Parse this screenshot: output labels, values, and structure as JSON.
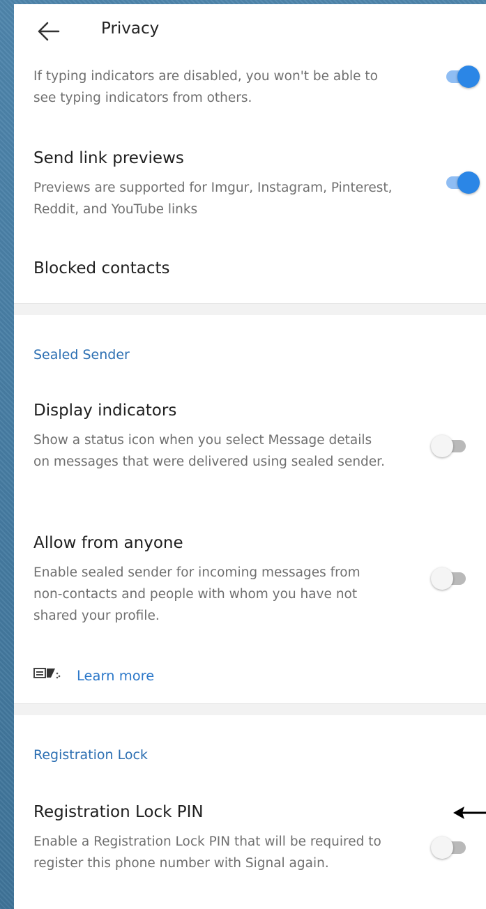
{
  "appbar": {
    "title": "Privacy",
    "back_icon": "back-arrow-icon"
  },
  "typing": {
    "subtitle": "If typing indicators are disabled, you won't be able to see typing indicators from others.",
    "enabled": true
  },
  "link_previews": {
    "title": "Send link previews",
    "subtitle": "Previews are supported for Imgur, Instagram, Pinterest, Reddit, and YouTube links",
    "enabled": true
  },
  "blocked": {
    "title": "Blocked contacts"
  },
  "sealed_sender": {
    "header": "Sealed Sender",
    "display_indicators": {
      "title": "Display indicators",
      "subtitle": "Show a status icon when you select Message details on messages that were delivered using sealed sender.",
      "enabled": false
    },
    "allow_anyone": {
      "title": "Allow from anyone",
      "subtitle": "Enable sealed sender for incoming messages from non-contacts and people with whom you have not shared your profile.",
      "enabled": false
    },
    "learn_more": {
      "label": "Learn more",
      "icon": "sealed-sender-icon"
    }
  },
  "registration_lock": {
    "header": "Registration Lock",
    "pin": {
      "title": "Registration Lock PIN",
      "subtitle": "Enable a Registration Lock PIN that will be required to register this phone number with Signal again.",
      "enabled": false
    }
  },
  "colors": {
    "accent": "#2b86e6",
    "section_header": "#2c6fb2",
    "frame": "#4a7fa6"
  }
}
